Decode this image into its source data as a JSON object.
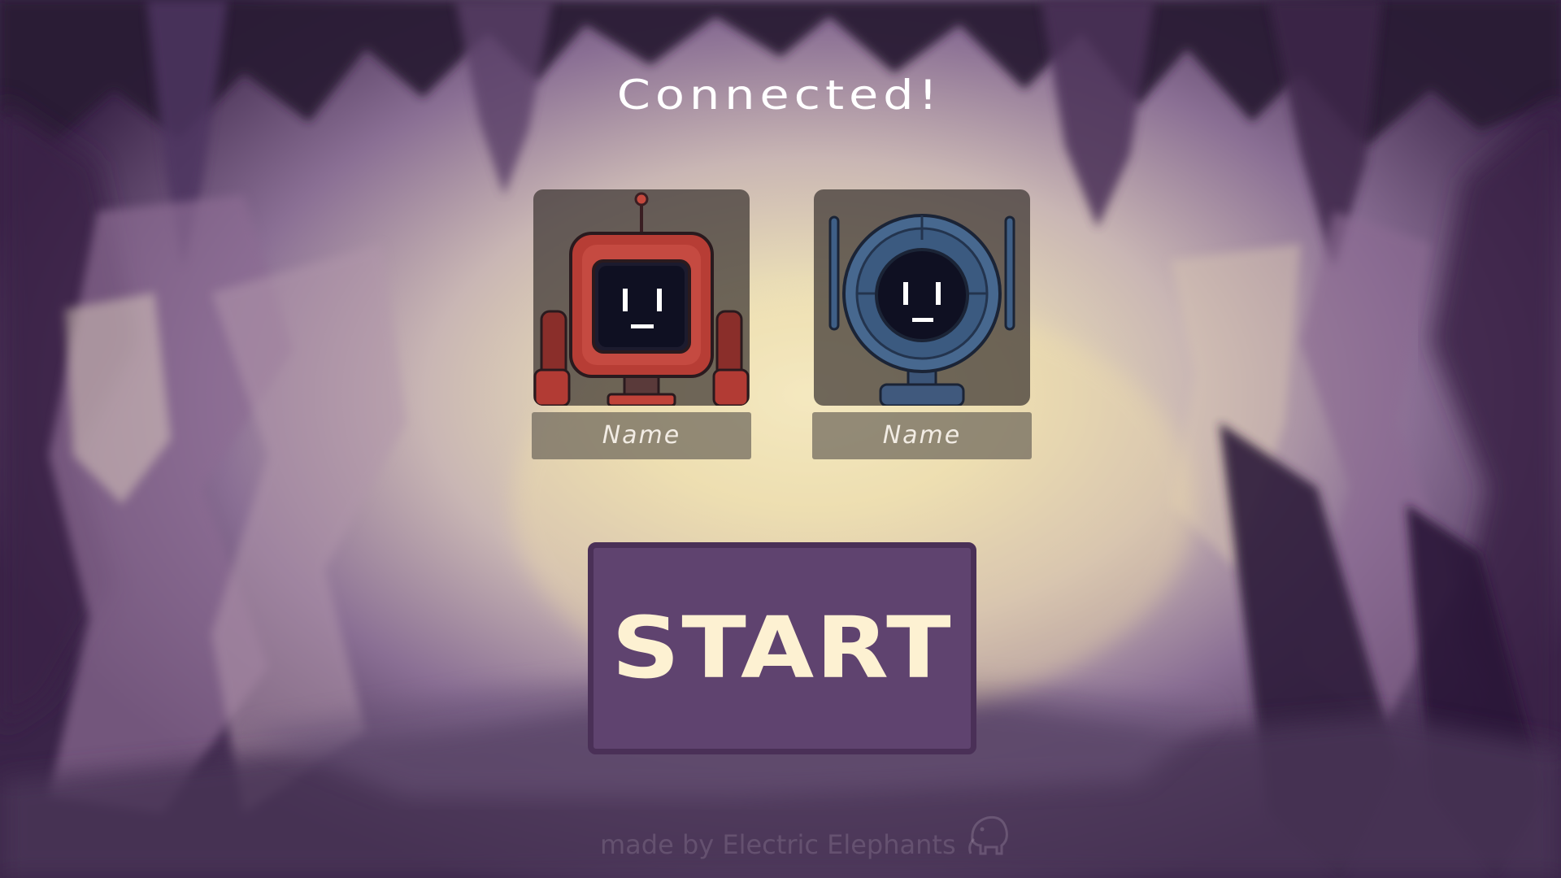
{
  "screen": {
    "title": "Connected!"
  },
  "players": [
    {
      "name": "Name",
      "avatar": "red-robot-avatar"
    },
    {
      "name": "Name",
      "avatar": "blue-robot-avatar"
    }
  ],
  "start_button": {
    "label": "START"
  },
  "footer": {
    "credit": "made by Electric Elephants",
    "logo": "elephant-logo-icon"
  },
  "colors": {
    "button_fill": "#5f436f",
    "button_border": "#4a3057",
    "button_text": "#fdf1d2",
    "title_text": "#ffffff"
  }
}
